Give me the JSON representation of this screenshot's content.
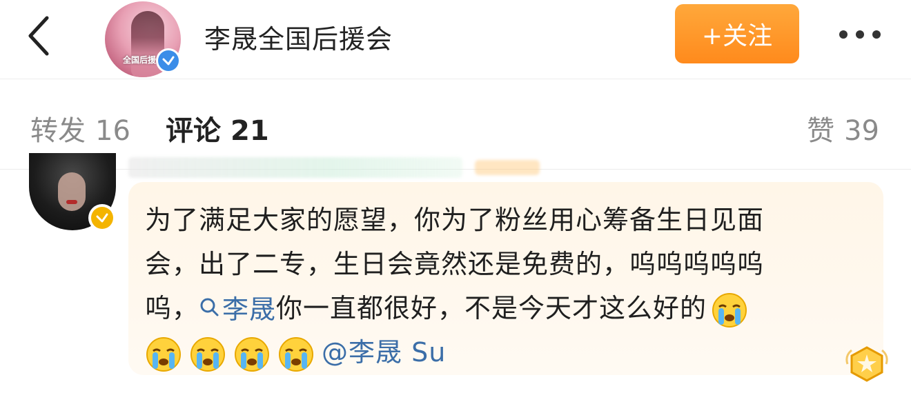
{
  "header": {
    "account_name": "李晟全国后援会",
    "avatar_text": "全国后援",
    "follow_label": "+关注",
    "icons": {
      "back": "chevron-left-icon",
      "more": "more-horizontal-icon",
      "verified": "verified-blue-icon"
    },
    "accent_color": "#ff961f"
  },
  "tabs": {
    "repost": {
      "label": "转发",
      "count": "16"
    },
    "comment": {
      "label": "评论",
      "count": "21"
    },
    "like": {
      "label": "赞",
      "count": "39"
    }
  },
  "comment": {
    "line1": "为了满足大家的愿望，你为了粉丝用心筹备生日见面",
    "line2": "会，出了二专，生日会竟然还是免费的，呜呜呜呜呜",
    "line3_prefix": "呜，",
    "search_mention": "李晟",
    "line3_suffix": "你一直都很好，不是今天才这么好的",
    "mention": "@李晟 Su",
    "emoji_name": "crying-face-icon",
    "verified": "verified-gold-icon",
    "medal": "medal-icon",
    "link_color": "#3b6ea8"
  }
}
